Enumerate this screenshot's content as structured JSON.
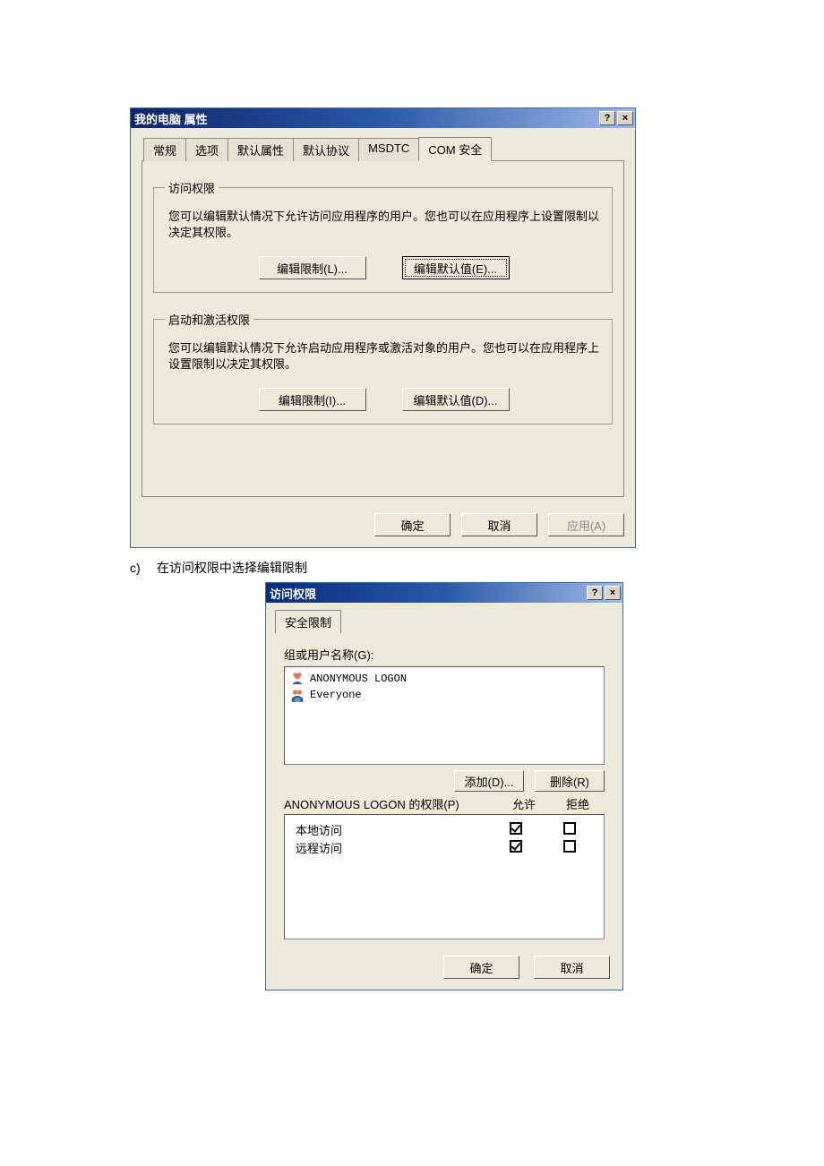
{
  "dialog1": {
    "title": "我的电脑 属性",
    "help_btn": "?",
    "close_btn": "×",
    "tabs": [
      "常规",
      "选项",
      "默认属性",
      "默认协议",
      "MSDTC",
      "COM 安全"
    ],
    "active_tab_index": 5,
    "group_access": {
      "legend": "访问权限",
      "desc": "您可以编辑默认情况下允许访问应用程序的用户。您也可以在应用程序上设置限制以决定其权限。",
      "btn_limit": "编辑限制(L)...",
      "btn_default": "编辑默认值(E)..."
    },
    "group_launch": {
      "legend": "启动和激活权限",
      "desc": "您可以编辑默认情况下允许启动应用程序或激活对象的用户。您也可以在应用程序上设置限制以决定其权限。",
      "btn_limit": "编辑限制(I)...",
      "btn_default": "编辑默认值(D)..."
    },
    "footer": {
      "ok": "确定",
      "cancel": "取消",
      "apply": "应用(A)"
    }
  },
  "caption": {
    "ord": "c)",
    "text": "在访问权限中选择编辑限制"
  },
  "dialog2": {
    "title": "访问权限",
    "help_btn": "?",
    "close_btn": "×",
    "tab": "安全限制",
    "group_label": "组或用户名称(G):",
    "users": [
      "ANONYMOUS LOGON",
      "Everyone"
    ],
    "btn_add": "添加(D)...",
    "btn_remove": "删除(R)",
    "perm_caption": "ANONYMOUS LOGON 的权限(P)",
    "col_allow": "允许",
    "col_deny": "拒绝",
    "perms": [
      {
        "name": "本地访问",
        "allow": true,
        "deny": false
      },
      {
        "name": "远程访问",
        "allow": true,
        "deny": false
      }
    ],
    "footer": {
      "ok": "确定",
      "cancel": "取消"
    }
  }
}
